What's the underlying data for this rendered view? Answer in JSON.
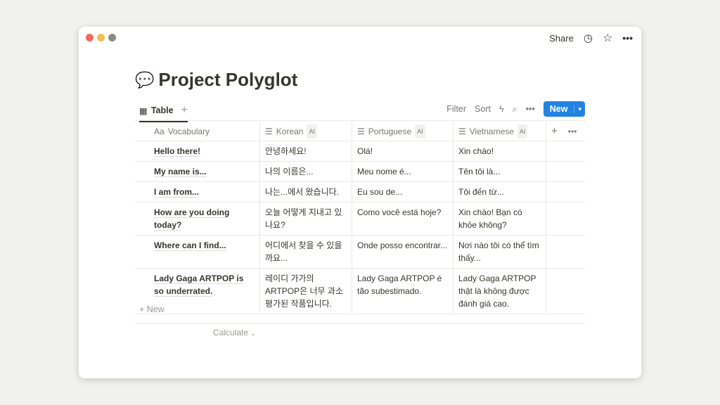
{
  "window": {
    "share": "Share"
  },
  "page": {
    "emoji": "💬",
    "title": "Project Polyglot"
  },
  "view": {
    "tab": "Table",
    "filter": "Filter",
    "sort": "Sort",
    "new": "New"
  },
  "columns": [
    {
      "label": "Vocabulary",
      "icon": "Aa"
    },
    {
      "label": "Korean",
      "badge": "AI"
    },
    {
      "label": "Portuguese",
      "badge": "AI"
    },
    {
      "label": "Vietnamese",
      "badge": "AI"
    }
  ],
  "rows": [
    [
      "Hello there!",
      "안녕하세요!",
      "Olá!",
      "Xin chào!"
    ],
    [
      "My name is...",
      "나의 이름은...",
      "Meu nome é...",
      "Tên tôi là..."
    ],
    [
      "I am from...",
      "나는...에서 왔습니다.",
      "Eu sou de...",
      "Tôi đến từ..."
    ],
    [
      "How are you doing today?",
      "오늘 어떻게 지내고 있나요?",
      "Como você está hoje?",
      "Xin chào! Bạn có khỏe không?"
    ],
    [
      "Where can I find...",
      "어디에서 찾을 수 있을까요...",
      "Onde posso encontrar...",
      "Nơi nào tôi có thể tìm thấy..."
    ],
    [
      "Lady Gaga ARTPOP is so underrated.",
      "레이디 가가의 ARTPOP은 너무 과소평가된 작품입니다.",
      "Lady Gaga ARTPOP é tão subestimado.",
      "Lady Gaga ARTPOP thật là không được đánh giá cao."
    ]
  ],
  "footer": {
    "new": "New",
    "calculate": "Calculate"
  }
}
